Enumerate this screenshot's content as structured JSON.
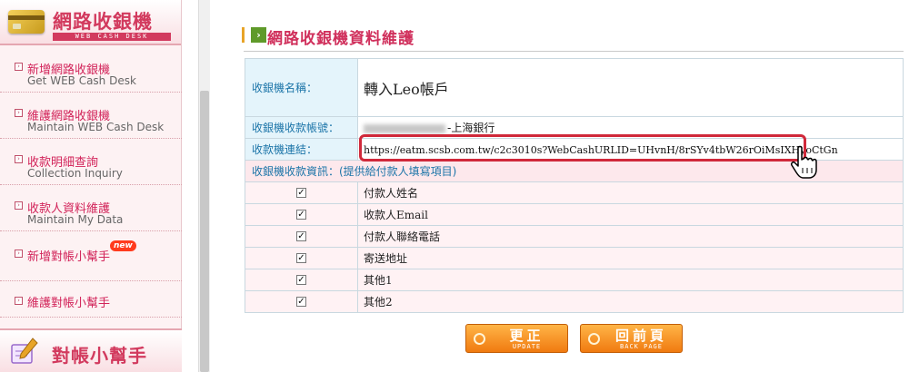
{
  "sidebar": {
    "title": "網路收銀機",
    "subtitle": "WEB CASH DESK",
    "items": [
      {
        "zh": "新增網路收銀機",
        "en": "Get WEB Cash Desk"
      },
      {
        "zh": "維護網路收銀機",
        "en": "Maintain WEB Cash Desk"
      },
      {
        "zh": "收款明細查詢",
        "en": "Collection Inquiry"
      },
      {
        "zh": "收款人資料維護",
        "en": "Maintain My Data"
      },
      {
        "zh": "新增對帳小幫手",
        "en": ""
      },
      {
        "zh": "維護對帳小幫手",
        "en": ""
      }
    ],
    "new_badge": "new",
    "footer_title": "對帳小幫手"
  },
  "main": {
    "heading": "網路收銀機資料維護",
    "rows": {
      "name_label": "收銀機名稱：",
      "name_value": "轉入Leo帳戶",
      "account_label": "收銀機收款帳號：",
      "account_bank": "-上海銀行",
      "link_label": "收款機連結：",
      "link_value": "https://eatm.scsb.com.tw/c2c3010s?WebCashURLID=UHvnH/8rSYv4tbW26rOiMsIXHyoCtGn",
      "payer_header": "收銀機收款資訊：(提供給付款人填寫項目)"
    },
    "fields": [
      {
        "label": "付款人姓名",
        "checked": true
      },
      {
        "label": "收款人Email",
        "checked": true
      },
      {
        "label": "付款人聯絡電話",
        "checked": true
      },
      {
        "label": "寄送地址",
        "checked": true
      },
      {
        "label": "其他1",
        "checked": true
      },
      {
        "label": "其他2",
        "checked": true
      }
    ],
    "buttons": {
      "update": {
        "label": "更正",
        "sub": "UPDATE"
      },
      "back": {
        "label": "回前頁",
        "sub": "BACK PAGE"
      }
    }
  },
  "colors": {
    "brand_pink": "#d23a5e",
    "label_blue": "#1b74a8",
    "button_orange": "#f07a10",
    "highlight_red": "#d0283a"
  }
}
